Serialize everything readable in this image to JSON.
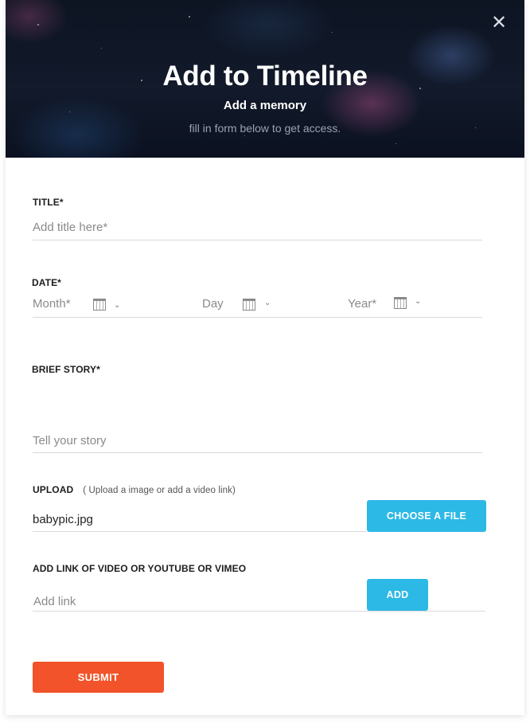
{
  "header": {
    "title": "Add to Timeline",
    "subtitle": "Add a memory",
    "note": "fill in form below to get access.",
    "close_icon": "close-icon"
  },
  "form": {
    "title": {
      "label": "TITLE*",
      "placeholder": "Add title here*"
    },
    "date": {
      "label": "DATE*",
      "month_placeholder": "Month*",
      "day_placeholder": "Day",
      "year_placeholder": "Year*",
      "calendar_icon": "calendar-icon"
    },
    "story": {
      "label": "BRIEF STORY*",
      "placeholder": "Tell your story"
    },
    "upload": {
      "label": "UPLOAD",
      "hint": "( Upload a image or add a video link)",
      "file_value": "babypic.jpg",
      "button_label": "CHOOSE A FILE"
    },
    "video_link": {
      "label": "ADD LINK OF VIDEO OR  YOUTUBE OR VIMEO",
      "placeholder": "Add link",
      "button_label": "ADD"
    },
    "submit_label": "SUBMIT"
  },
  "colors": {
    "accent_blue": "#2db9e6",
    "submit_orange": "#f2532a",
    "header_bg": "#121a2b"
  }
}
